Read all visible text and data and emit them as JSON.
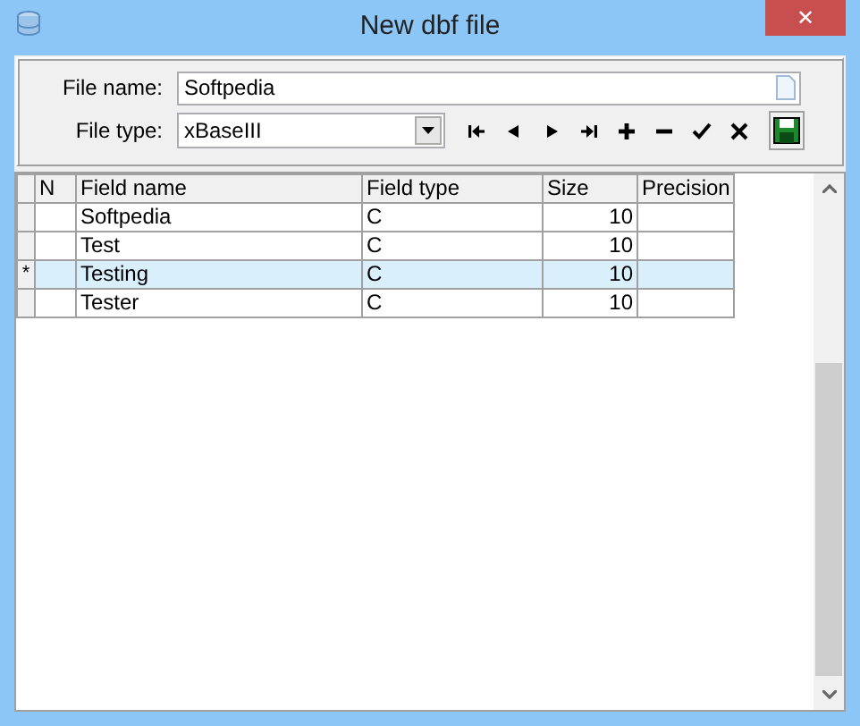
{
  "window": {
    "title": "New dbf file",
    "close": "✕"
  },
  "form": {
    "file_name": {
      "label": "File name:",
      "value": "Softpedia"
    },
    "file_type": {
      "label": "File type:",
      "value": "xBaseIII"
    }
  },
  "navigator": [
    {
      "kind": "first"
    },
    {
      "kind": "prior"
    },
    {
      "kind": "next"
    },
    {
      "kind": "last"
    },
    {
      "kind": "insert"
    },
    {
      "kind": "delete"
    },
    {
      "kind": "post"
    },
    {
      "kind": "cancel"
    }
  ],
  "table": {
    "columns": [
      "N",
      "Field name",
      "Field type",
      "Size",
      "Precision"
    ],
    "rows": [
      {
        "selected": false,
        "cells": [
          "",
          "Softpedia",
          "C",
          "10",
          ""
        ]
      },
      {
        "selected": false,
        "cells": [
          "",
          "Test",
          "C",
          "10",
          ""
        ]
      },
      {
        "selected": true,
        "indicator": "*",
        "cells": [
          "",
          "Testing",
          "C",
          "10",
          ""
        ]
      },
      {
        "selected": false,
        "cells": [
          "",
          "Tester",
          "C",
          "10",
          ""
        ]
      }
    ]
  }
}
